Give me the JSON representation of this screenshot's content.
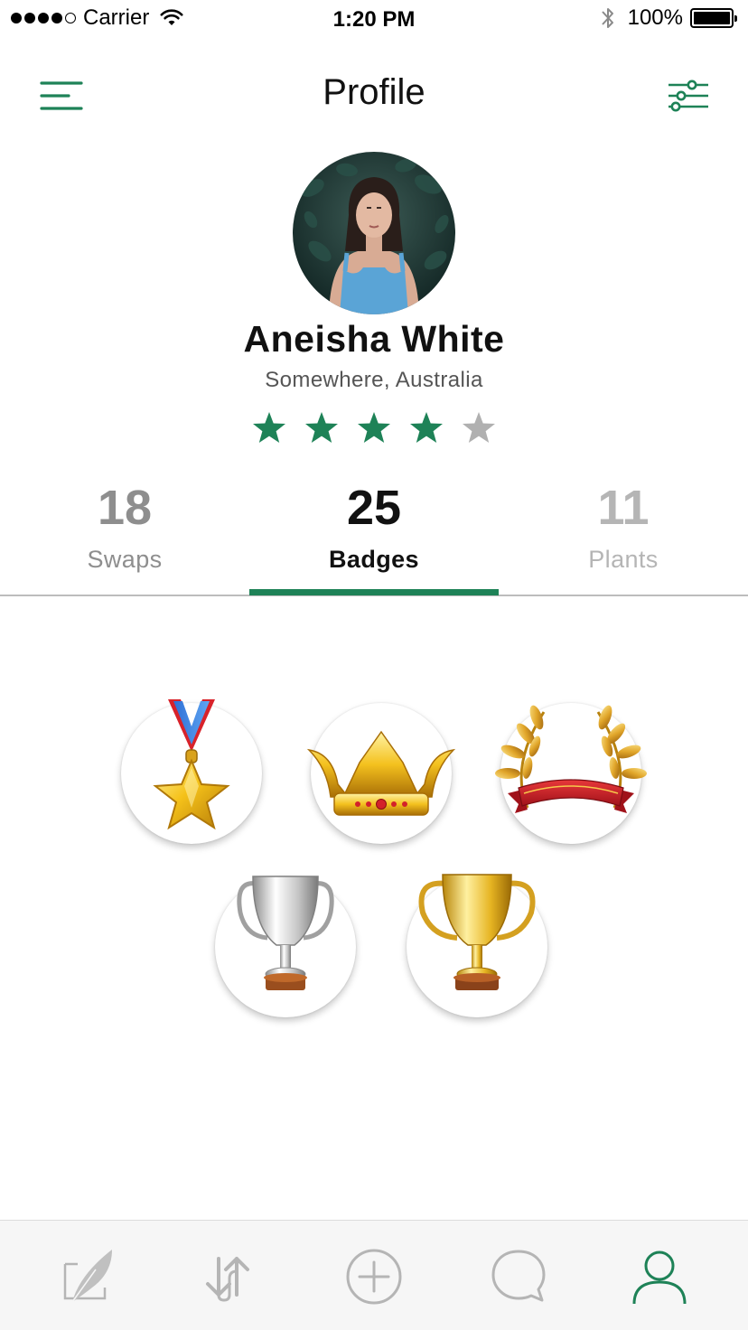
{
  "status_bar": {
    "carrier": "Carrier",
    "time": "1:20 PM",
    "battery": "100%"
  },
  "nav": {
    "title": "Profile",
    "menu_icon": "hamburger-menu-icon",
    "filter_icon": "filter-sliders-icon"
  },
  "profile": {
    "name": "Aneisha White",
    "location": "Somewhere, Australia",
    "rating": 4,
    "rating_max": 5
  },
  "stats": [
    {
      "value": "18",
      "label": "Swaps"
    },
    {
      "value": "25",
      "label": "Badges"
    },
    {
      "value": "11",
      "label": "Plants"
    }
  ],
  "selected_tab": "Badges",
  "badges": [
    {
      "icon": "star-medal-icon"
    },
    {
      "icon": "crown-icon"
    },
    {
      "icon": "laurel-wreath-icon"
    },
    {
      "icon": "silver-trophy-icon"
    },
    {
      "icon": "gold-trophy-icon"
    }
  ],
  "tab_bar": [
    {
      "icon": "feather-post-icon",
      "active": false
    },
    {
      "icon": "swap-arrows-icon",
      "active": false
    },
    {
      "icon": "add-circle-icon",
      "active": false
    },
    {
      "icon": "chat-bubble-icon",
      "active": false
    },
    {
      "icon": "profile-person-icon",
      "active": true
    }
  ],
  "colors": {
    "accent": "#1e8257",
    "star_inactive": "#b0b0b0",
    "tab_inactive": "#b5b5b5",
    "separator": "#bdbdbd"
  }
}
